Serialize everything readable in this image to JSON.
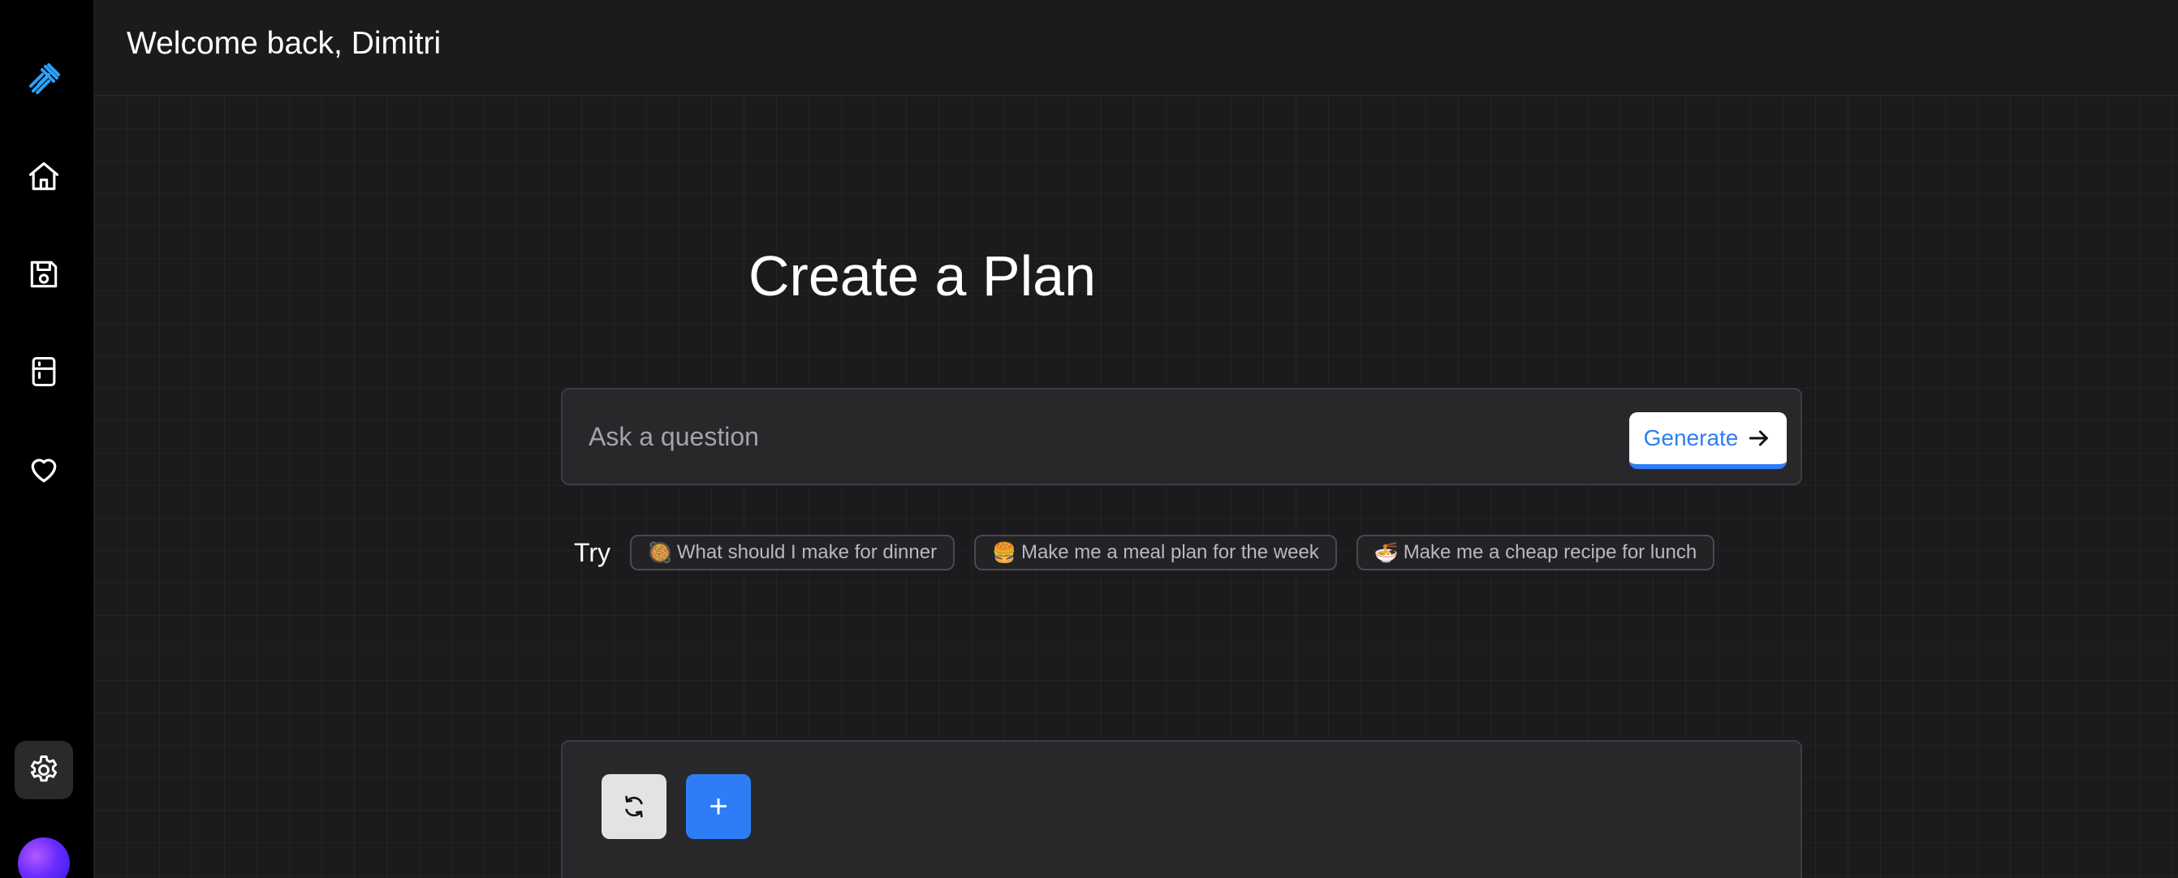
{
  "header": {
    "welcome": "Welcome back, Dimitri"
  },
  "main": {
    "title": "Create a Plan",
    "ask": {
      "placeholder": "Ask a question",
      "value": ""
    },
    "generate_label": "Generate",
    "try_label": "Try",
    "suggestions": [
      {
        "emoji": "🥘",
        "label": "What should I make for dinner"
      },
      {
        "emoji": "🍔",
        "label": "Make me a meal plan for the week"
      },
      {
        "emoji": "🍜",
        "label": "Make me a cheap recipe for lunch"
      }
    ],
    "add_label": "+"
  },
  "sidebar": {
    "icons": [
      "dumbbell-logo-icon",
      "home-icon",
      "save-icon",
      "fridge-icon",
      "heart-icon",
      "gear-icon"
    ]
  },
  "colors": {
    "accent": "#2f7df6",
    "logo": "#29a3ff",
    "background": "#1b1b1d",
    "sidebar": "#000000"
  }
}
